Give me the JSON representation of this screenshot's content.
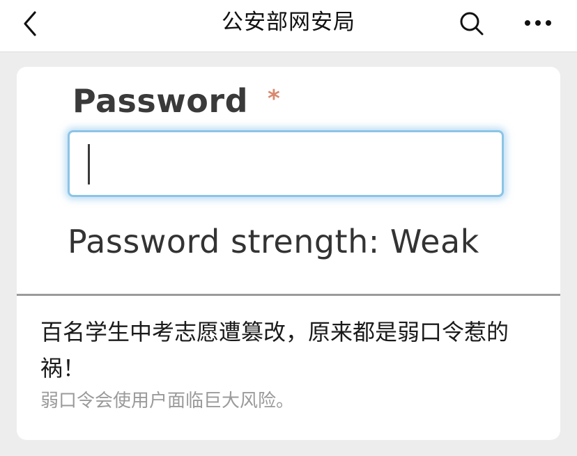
{
  "topbar": {
    "title": "公安部网安局",
    "back_icon": "chevron-left-icon",
    "search_icon": "search-icon",
    "more_icon": "more-horizontal-icon"
  },
  "cover": {
    "field_label": "Password",
    "required_mark": "*",
    "input_value": "",
    "strength_text": "Password strength: Weak"
  },
  "article": {
    "title": "百名学生中考志愿遭篡改，原来都是弱口令惹的祸！",
    "summary": "弱口令会使用户面临巨大风险。"
  },
  "colors": {
    "background": "#ededed",
    "input_focus_border": "#8cc4e6",
    "required_mark": "#d8896f",
    "summary_text": "#9a9a9a"
  }
}
